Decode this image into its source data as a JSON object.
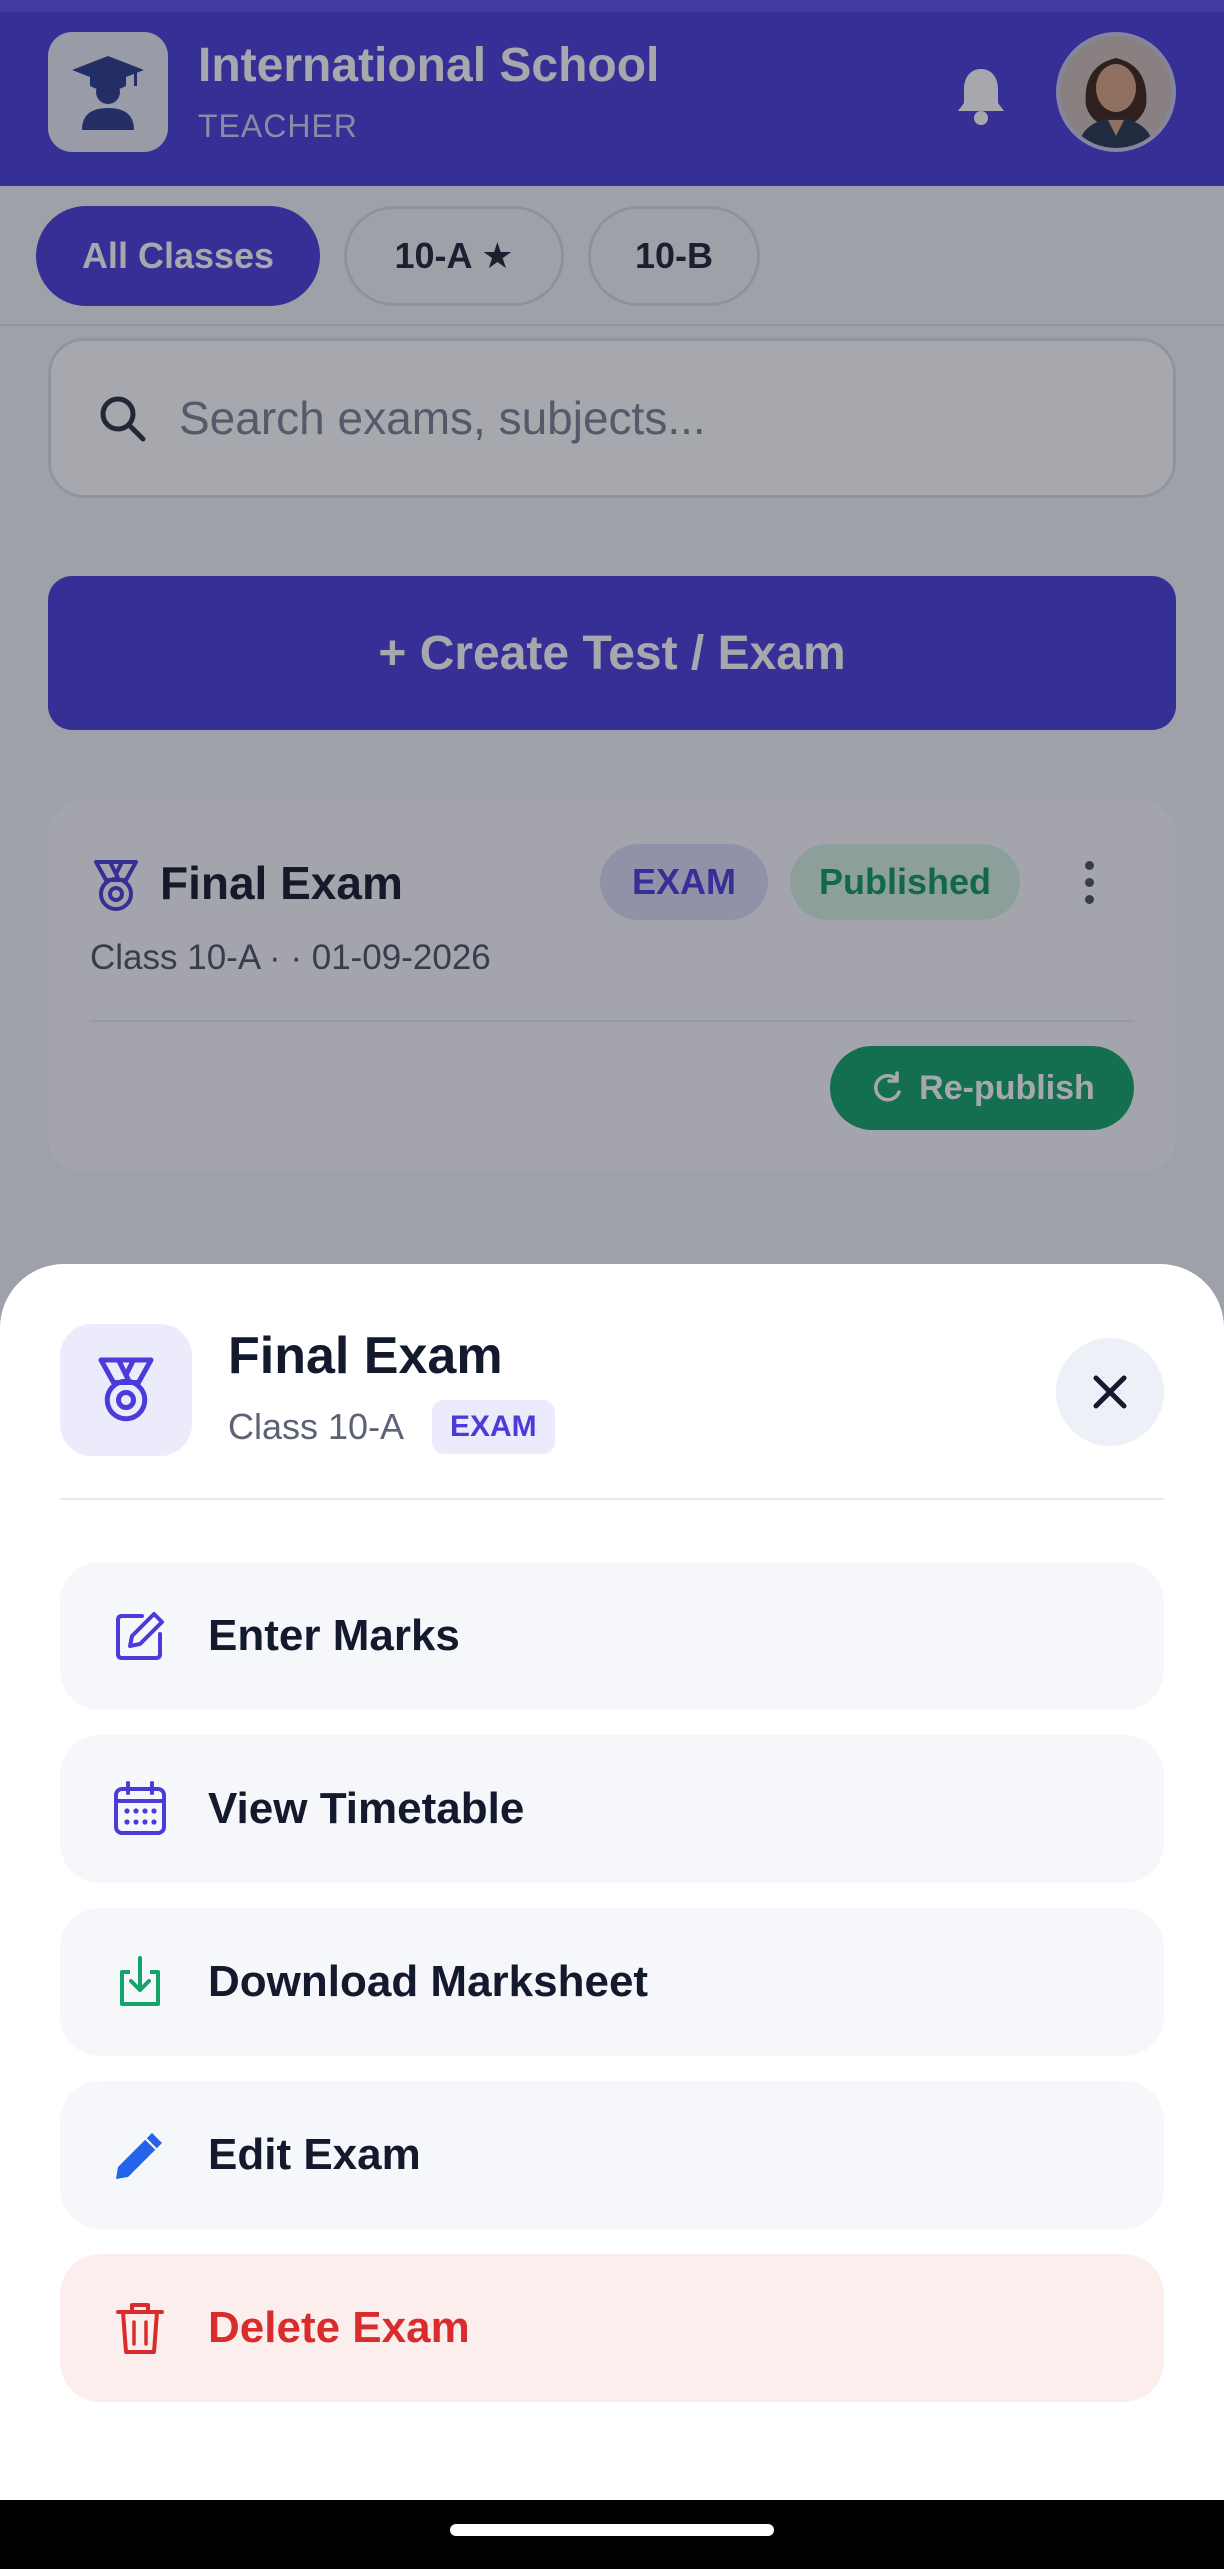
{
  "app": {
    "school_name": "International School",
    "role": "TEACHER"
  },
  "class_tabs": [
    {
      "label": "All Classes",
      "active": true
    },
    {
      "label": "10-A ★",
      "active": false
    },
    {
      "label": "10-B",
      "active": false
    }
  ],
  "search": {
    "placeholder": "Search exams, subjects..."
  },
  "create_button": {
    "label": "+ Create Test / Exam"
  },
  "exam_card": {
    "title": "Final Exam",
    "type_badge": "EXAM",
    "status_badge": "Published",
    "subtitle": "Class 10-A ·  · 01-09-2026",
    "republish_label": "Re-publish"
  },
  "sheet": {
    "title": "Final Exam",
    "class_label": "Class 10-A",
    "type_badge": "EXAM",
    "actions": [
      {
        "label": "Enter Marks",
        "icon": "edit-square-icon",
        "color": "#4a3cd9"
      },
      {
        "label": "View Timetable",
        "icon": "calendar-icon",
        "color": "#4a3cd9"
      },
      {
        "label": "Download Marksheet",
        "icon": "download-icon",
        "color": "#12a46a"
      },
      {
        "label": "Edit Exam",
        "icon": "pencil-icon",
        "color": "#2563eb"
      },
      {
        "label": "Delete Exam",
        "icon": "trash-icon",
        "color": "#d92d2d"
      }
    ]
  },
  "colors": {
    "primary": "#4a3cd9",
    "success": "#12a46a",
    "danger": "#d92d2d"
  }
}
